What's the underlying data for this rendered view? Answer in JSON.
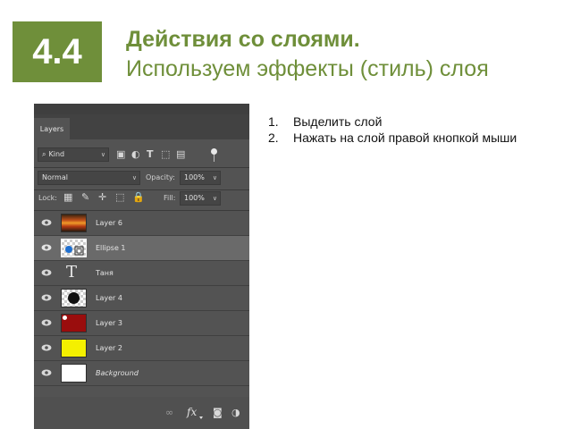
{
  "slide": {
    "number": "4.4",
    "title_line1": "Действия со слоями.",
    "title_line2": "Используем эффекты (стиль) слоя",
    "steps": [
      {
        "num": "1.",
        "text": "Выделить слой"
      },
      {
        "num": "2.",
        "text": "Нажать на слой правой кнопкой мыши"
      }
    ]
  },
  "panel": {
    "tab_label": "Layers",
    "filter_kind": "Kind",
    "blend_mode": "Normal",
    "opacity_label": "Opacity:",
    "opacity_value": "100%",
    "lock_label": "Lock:",
    "fill_label": "Fill:",
    "fill_value": "100%",
    "layers": [
      {
        "name": "Layer 6",
        "thumb": "fire",
        "selected": false
      },
      {
        "name": "Ellipse 1",
        "thumb": "ellipse",
        "selected": true
      },
      {
        "name": "Таня",
        "thumb": "text",
        "selected": false
      },
      {
        "name": "Layer 4",
        "thumb": "black-circle",
        "selected": false
      },
      {
        "name": "Layer 3",
        "thumb": "darkred",
        "selected": false
      },
      {
        "name": "Layer 2",
        "thumb": "yellow",
        "selected": false
      },
      {
        "name": "Background",
        "thumb": "white",
        "selected": false
      }
    ],
    "footer_icons": [
      "link-icon",
      "fx-icon",
      "adjustment-icon"
    ],
    "colors": {
      "panel": "#535353",
      "selected_row": "#6a6a6a",
      "accent_green": "#6f8f3a"
    }
  }
}
